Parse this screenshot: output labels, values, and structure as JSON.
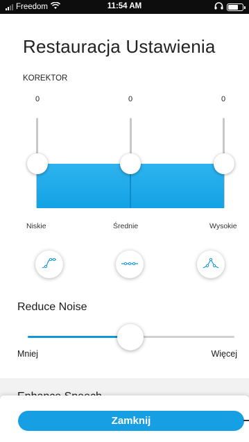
{
  "status_bar": {
    "carrier": "Freedom",
    "time": "11:54 AM"
  },
  "page": {
    "title": "Restauracja Ustawienia"
  },
  "equalizer": {
    "section_label": "KOREKTOR",
    "bands": [
      {
        "label": "Niskie",
        "value": "0",
        "level": 0
      },
      {
        "label": "Średnie",
        "value": "0",
        "level": 0
      },
      {
        "label": "Wysokie",
        "value": "0",
        "level": 0
      }
    ],
    "presets": [
      {
        "icon": "eq-curve-bass-boost-icon"
      },
      {
        "icon": "eq-curve-flat-icon"
      },
      {
        "icon": "eq-curve-mid-peak-icon"
      }
    ],
    "accent_color": "#12a2e5"
  },
  "reduce_noise": {
    "title": "Reduce Noise",
    "min_label": "Mniej",
    "max_label": "Więcej",
    "level_fraction": 0.5
  },
  "enhance_speech": {
    "title": "Enhance Speech"
  },
  "footer": {
    "close_label": "Zamknij"
  }
}
